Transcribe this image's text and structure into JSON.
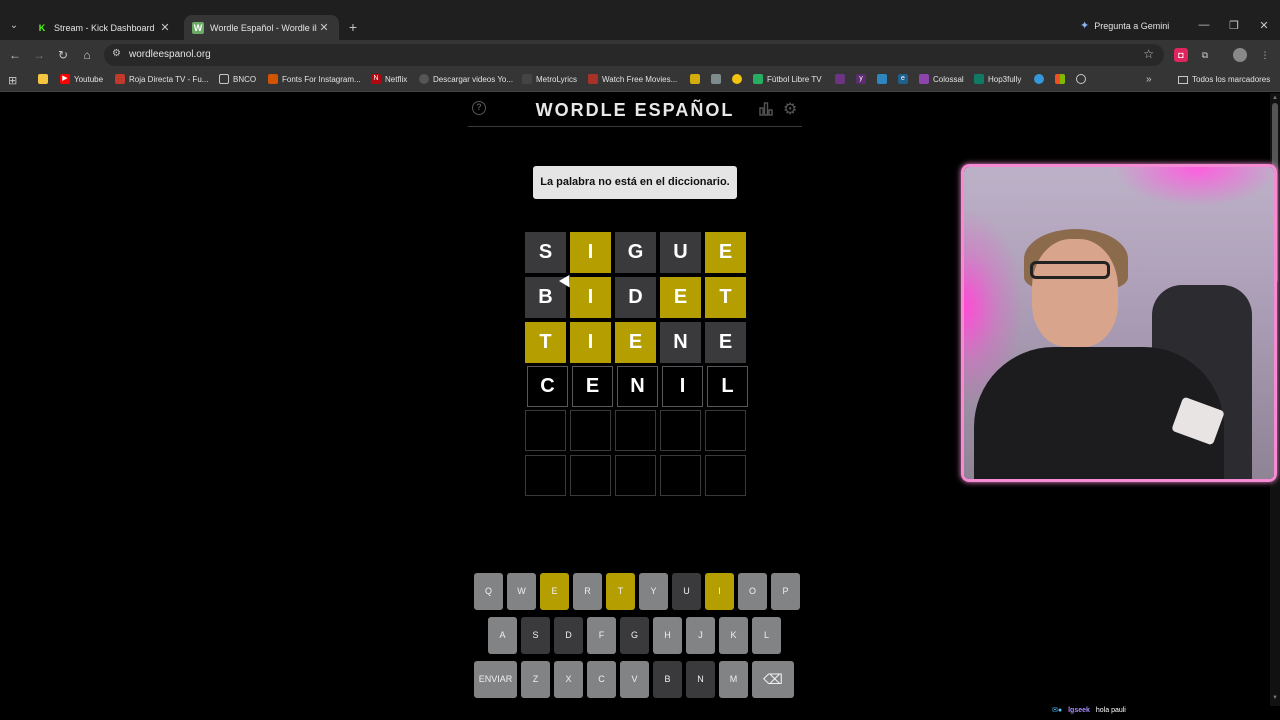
{
  "browser": {
    "tabs": [
      {
        "title": "Stream - Kick Dashboard",
        "icon": "kick-icon",
        "active": false
      },
      {
        "title": "Wordle Español - Wordle ilimitado",
        "icon": "wordle-icon",
        "active": true
      }
    ],
    "gemini_label": "Pregunta a Gemini",
    "url": "wordleespanol.org",
    "bookmarks": [
      "Youtube",
      "Roja Directa TV - Fu...",
      "BNCO",
      "Fonts For Instagram...",
      "Netflix",
      "Descargar videos Yo...",
      "MetroLyrics",
      "Watch Free Movies...",
      "Fútbol Libre TV",
      "Colossal",
      "Hop3fully"
    ],
    "all_bookmarks": "Todos los marcadores"
  },
  "game": {
    "title": "WORDLE ESPAÑOL",
    "toast": "La palabra no está en el diccionario.",
    "board": [
      [
        {
          "l": "S",
          "s": "absent"
        },
        {
          "l": "I",
          "s": "present"
        },
        {
          "l": "G",
          "s": "absent"
        },
        {
          "l": "U",
          "s": "absent"
        },
        {
          "l": "E",
          "s": "present"
        }
      ],
      [
        {
          "l": "B",
          "s": "absent"
        },
        {
          "l": "I",
          "s": "present"
        },
        {
          "l": "D",
          "s": "absent"
        },
        {
          "l": "E",
          "s": "present"
        },
        {
          "l": "T",
          "s": "present"
        }
      ],
      [
        {
          "l": "T",
          "s": "present"
        },
        {
          "l": "I",
          "s": "present"
        },
        {
          "l": "E",
          "s": "present"
        },
        {
          "l": "N",
          "s": "absent"
        },
        {
          "l": "E",
          "s": "absent"
        }
      ],
      [
        {
          "l": "C",
          "s": "typed"
        },
        {
          "l": "E",
          "s": "typed"
        },
        {
          "l": "N",
          "s": "typed"
        },
        {
          "l": "I",
          "s": "typed"
        },
        {
          "l": "L",
          "s": "typed"
        }
      ],
      [
        {
          "l": "",
          "s": "empty"
        },
        {
          "l": "",
          "s": "empty"
        },
        {
          "l": "",
          "s": "empty"
        },
        {
          "l": "",
          "s": "empty"
        },
        {
          "l": "",
          "s": "empty"
        }
      ],
      [
        {
          "l": "",
          "s": "empty"
        },
        {
          "l": "",
          "s": "empty"
        },
        {
          "l": "",
          "s": "empty"
        },
        {
          "l": "",
          "s": "empty"
        },
        {
          "l": "",
          "s": "empty"
        }
      ]
    ],
    "keyboard": [
      [
        {
          "k": "Q",
          "s": "unused"
        },
        {
          "k": "W",
          "s": "unused"
        },
        {
          "k": "E",
          "s": "present"
        },
        {
          "k": "R",
          "s": "unused"
        },
        {
          "k": "T",
          "s": "present"
        },
        {
          "k": "Y",
          "s": "unused"
        },
        {
          "k": "U",
          "s": "absent"
        },
        {
          "k": "I",
          "s": "present"
        },
        {
          "k": "O",
          "s": "unused"
        },
        {
          "k": "P",
          "s": "unused"
        }
      ],
      [
        {
          "k": "A",
          "s": "unused"
        },
        {
          "k": "S",
          "s": "absent"
        },
        {
          "k": "D",
          "s": "absent"
        },
        {
          "k": "F",
          "s": "unused"
        },
        {
          "k": "G",
          "s": "absent"
        },
        {
          "k": "H",
          "s": "unused"
        },
        {
          "k": "J",
          "s": "unused"
        },
        {
          "k": "K",
          "s": "unused"
        },
        {
          "k": "L",
          "s": "unused"
        }
      ],
      [
        {
          "k": "ENVIAR",
          "s": "unused"
        },
        {
          "k": "Z",
          "s": "unused"
        },
        {
          "k": "X",
          "s": "unused"
        },
        {
          "k": "C",
          "s": "unused"
        },
        {
          "k": "V",
          "s": "unused"
        },
        {
          "k": "B",
          "s": "absent"
        },
        {
          "k": "N",
          "s": "absent"
        },
        {
          "k": "M",
          "s": "unused"
        },
        {
          "k": "⌫",
          "s": "unused"
        }
      ]
    ]
  },
  "chat": {
    "badge": "lgseek",
    "message": "hola pauli"
  },
  "colors": {
    "present": "#b59f00",
    "absent": "#3a3a3c",
    "unused": "#818384",
    "cam_border": "#f58bd3"
  }
}
